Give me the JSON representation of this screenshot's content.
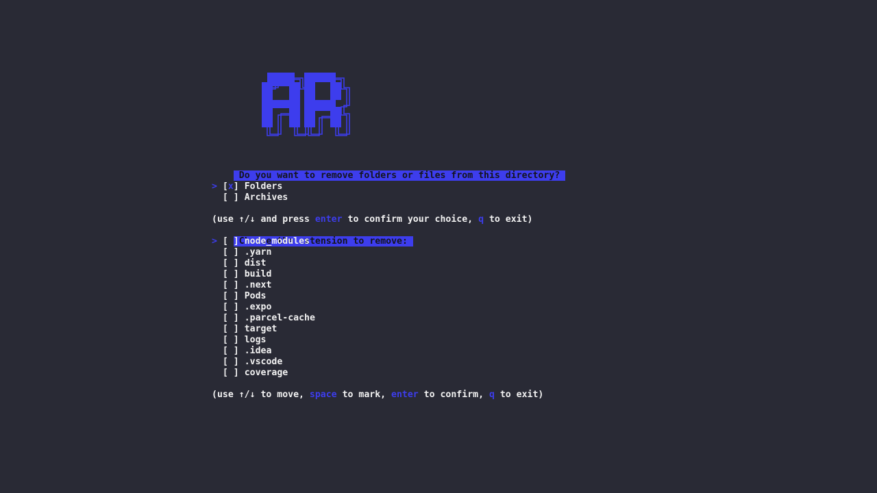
{
  "app": {
    "logo_text": "RR"
  },
  "step1": {
    "question": "Do you want to remove folders or files from this directory?",
    "options": [
      {
        "cursor": ">",
        "mark": "x",
        "label": "Folders"
      },
      {
        "cursor": " ",
        "mark": " ",
        "label": "Archives"
      }
    ],
    "help": {
      "prefix": "(use ↑/↓ and press ",
      "key1": "enter",
      "mid": " to confirm your choice, ",
      "key2": "q",
      "suffix": " to exit)"
    }
  },
  "step2": {
    "question": "Choose the extension to remove:",
    "items": [
      {
        "cursor": ">",
        "mark": " ",
        "label": "node_modules"
      },
      {
        "cursor": " ",
        "mark": " ",
        "label": ".yarn"
      },
      {
        "cursor": " ",
        "mark": " ",
        "label": "dist"
      },
      {
        "cursor": " ",
        "mark": " ",
        "label": "build"
      },
      {
        "cursor": " ",
        "mark": " ",
        "label": ".next"
      },
      {
        "cursor": " ",
        "mark": " ",
        "label": "Pods"
      },
      {
        "cursor": " ",
        "mark": " ",
        "label": ".expo"
      },
      {
        "cursor": " ",
        "mark": " ",
        "label": ".parcel-cache"
      },
      {
        "cursor": " ",
        "mark": " ",
        "label": "target"
      },
      {
        "cursor": " ",
        "mark": " ",
        "label": "logs"
      },
      {
        "cursor": " ",
        "mark": " ",
        "label": ".idea"
      },
      {
        "cursor": " ",
        "mark": " ",
        "label": ".vscode"
      },
      {
        "cursor": " ",
        "mark": " ",
        "label": "coverage"
      }
    ],
    "help": {
      "prefix": "(use ↑/↓ to move, ",
      "key1": "space",
      "mid1": " to mark, ",
      "key2": "enter",
      "mid2": " to confirm, ",
      "key3": "q",
      "suffix": " to exit)"
    }
  },
  "colors": {
    "background": "#292a35",
    "accent": "#3d3ded",
    "text": "#f2f2f2",
    "banner_text": "#14141c"
  }
}
